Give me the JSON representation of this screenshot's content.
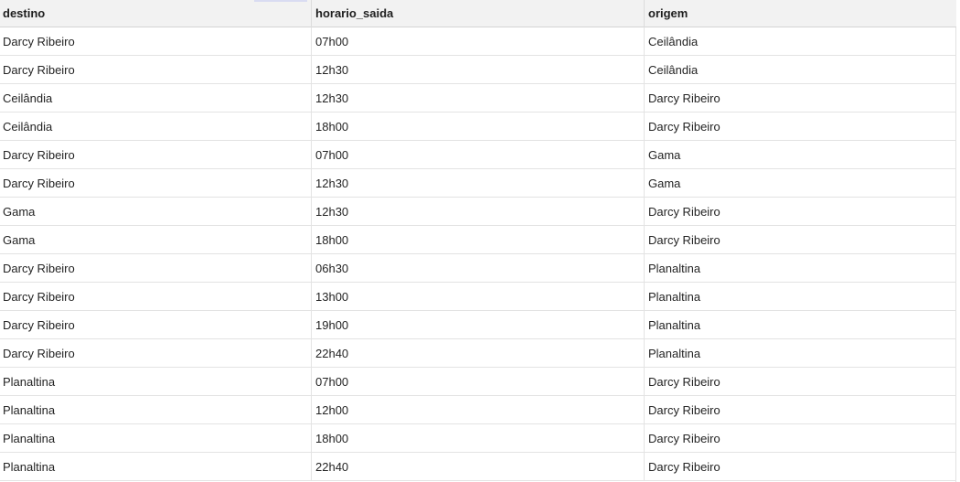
{
  "table": {
    "columns": [
      "destino",
      "horario_saida",
      "origem"
    ],
    "rows": [
      [
        "Darcy Ribeiro",
        "07h00",
        "Ceilândia"
      ],
      [
        "Darcy Ribeiro",
        "12h30",
        "Ceilândia"
      ],
      [
        "Ceilândia",
        "12h30",
        "Darcy Ribeiro"
      ],
      [
        "Ceilândia",
        "18h00",
        "Darcy Ribeiro"
      ],
      [
        "Darcy Ribeiro",
        "07h00",
        "Gama"
      ],
      [
        "Darcy Ribeiro",
        "12h30",
        "Gama"
      ],
      [
        "Gama",
        "12h30",
        "Darcy Ribeiro"
      ],
      [
        "Gama",
        "18h00",
        "Darcy Ribeiro"
      ],
      [
        "Darcy Ribeiro",
        "06h30",
        "Planaltina"
      ],
      [
        "Darcy Ribeiro",
        "13h00",
        "Planaltina"
      ],
      [
        "Darcy Ribeiro",
        "19h00",
        "Planaltina"
      ],
      [
        "Darcy Ribeiro",
        "22h40",
        "Planaltina"
      ],
      [
        "Planaltina",
        "07h00",
        "Darcy Ribeiro"
      ],
      [
        "Planaltina",
        "12h00",
        "Darcy Ribeiro"
      ],
      [
        "Planaltina",
        "18h00",
        "Darcy Ribeiro"
      ],
      [
        "Planaltina",
        "22h40",
        "Darcy Ribeiro"
      ]
    ]
  }
}
